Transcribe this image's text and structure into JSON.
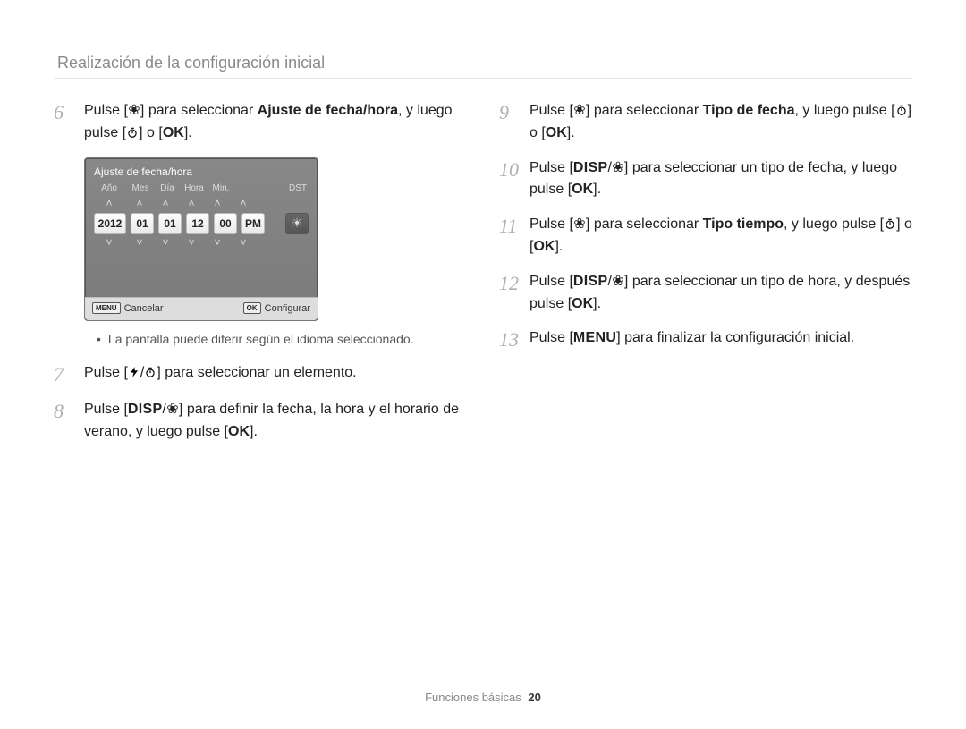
{
  "header": "Realización de la configuración inicial",
  "icons": {
    "macro": "❀",
    "timer": "⏲",
    "flash": "⚡",
    "sun": "☀",
    "slash": "/",
    "up": "˄",
    "down": "˅"
  },
  "labels": {
    "pulse": "Pulse",
    "disp": "DISP",
    "ok": "OK",
    "menu": "MENU",
    "o": "o"
  },
  "steps": {
    "s6": {
      "num": "6",
      "t1": " [",
      "t2": "] para seleccionar ",
      "bold": "Ajuste de fecha/hora",
      "t3": ", y luego pulse [",
      "t4": "] o [",
      "t5": "]."
    },
    "s7": {
      "num": "7",
      "t1": " [",
      "t2": "/",
      "t3": "] para seleccionar un elemento."
    },
    "s8": {
      "num": "8",
      "t1": " [",
      "t2": "/",
      "t3": "] para definir la fecha, la hora y el horario de verano, y luego pulse [",
      "t4": "]."
    },
    "s9": {
      "num": "9",
      "t1": " [",
      "t2": "] para seleccionar ",
      "bold": "Tipo de fecha",
      "t3": ", y luego pulse [",
      "t4": "] o [",
      "t5": "]."
    },
    "s10": {
      "num": "10",
      "t1": " [",
      "t2": "/",
      "t3": "] para seleccionar un tipo de fecha, y luego pulse [",
      "t4": "]."
    },
    "s11": {
      "num": "11",
      "t1": " [",
      "t2": "] para seleccionar ",
      "bold": "Tipo tiempo",
      "t3": ", y luego pulse [",
      "t4": "] o [",
      "t5": "]."
    },
    "s12": {
      "num": "12",
      "t1": " [",
      "t2": "/",
      "t3": "] para seleccionar un tipo de hora, y después pulse [",
      "t4": "]."
    },
    "s13": {
      "num": "13",
      "t1": " [",
      "t2": "] para finalizar la configuración inicial."
    }
  },
  "screen": {
    "title": "Ajuste de fecha/hora",
    "headers": {
      "year": "Año",
      "month": "Mes",
      "day": "Día",
      "hour": "Hora",
      "min": "Min.",
      "dst": "DST"
    },
    "values": {
      "year": "2012",
      "month": "01",
      "day": "01",
      "hour": "12",
      "min": "00",
      "ampm": "PM"
    },
    "footer": {
      "cancel_key": "MENU",
      "cancel": "Cancelar",
      "ok_key": "OK",
      "ok": "Configurar"
    }
  },
  "note": "La pantalla puede diferir según el idioma seleccionado.",
  "footer": {
    "section": "Funciones básicas",
    "page": "20"
  }
}
